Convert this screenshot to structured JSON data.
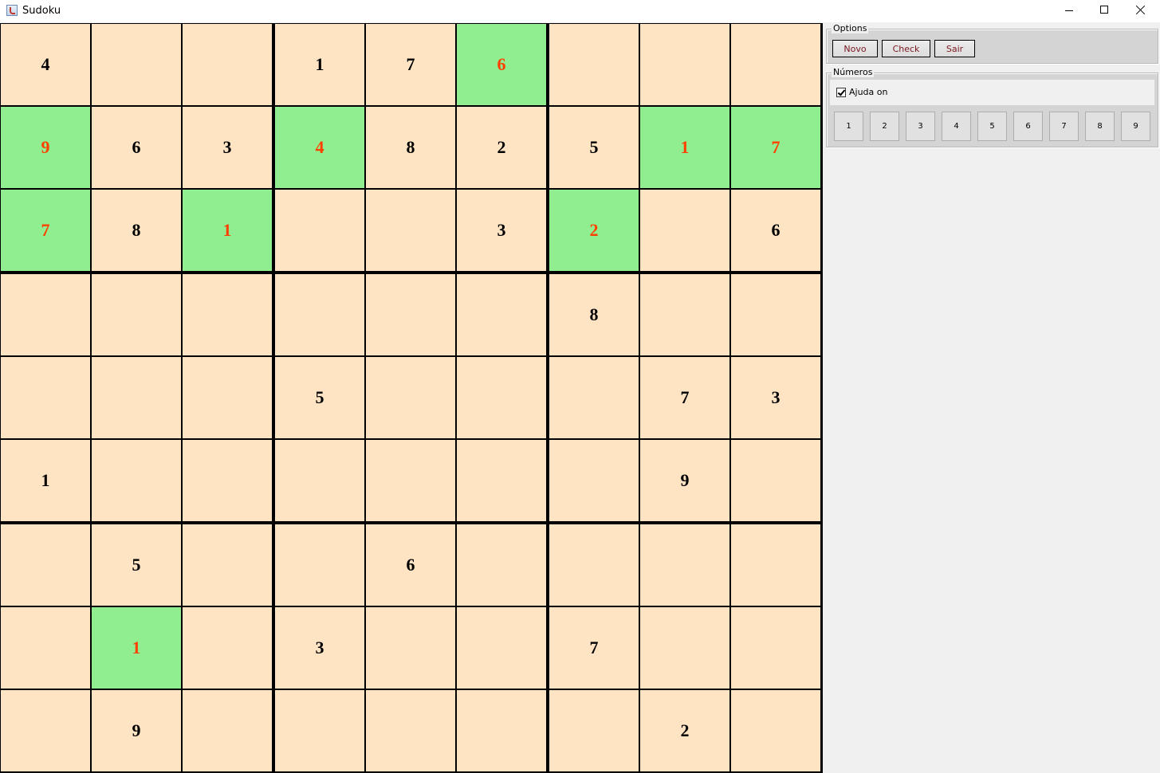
{
  "window": {
    "title": "Sudoku"
  },
  "board": {
    "rows": [
      [
        "4",
        "",
        "",
        "1",
        "7",
        "6",
        "",
        "",
        ""
      ],
      [
        "9",
        "6",
        "3",
        "4",
        "8",
        "2",
        "5",
        "1",
        "7"
      ],
      [
        "7",
        "8",
        "1",
        "",
        "",
        "3",
        "2",
        "",
        "6"
      ],
      [
        "",
        "",
        "",
        "",
        "",
        "",
        "8",
        "",
        ""
      ],
      [
        "",
        "",
        "",
        "5",
        "",
        "",
        "",
        "7",
        "3"
      ],
      [
        "1",
        "",
        "",
        "",
        "",
        "",
        "",
        "9",
        ""
      ],
      [
        "",
        "5",
        "",
        "",
        "6",
        "",
        "",
        "",
        ""
      ],
      [
        "",
        "1",
        "",
        "3",
        "",
        "",
        "7",
        "",
        ""
      ],
      [
        "",
        "9",
        "",
        "",
        "",
        "",
        "",
        "2",
        ""
      ]
    ],
    "highlighted": [
      [
        0,
        5
      ],
      [
        1,
        0
      ],
      [
        1,
        3
      ],
      [
        1,
        7
      ],
      [
        1,
        8
      ],
      [
        2,
        0
      ],
      [
        2,
        2
      ],
      [
        2,
        6
      ],
      [
        7,
        1
      ]
    ],
    "colors": {
      "cell_bg": "#ffe4c4",
      "highlight_bg": "#90ee90",
      "highlight_text": "#ff4000",
      "digit_text": "#000000"
    }
  },
  "options": {
    "legend": "Options",
    "buttons": [
      {
        "id": "novo",
        "label": "Novo"
      },
      {
        "id": "check",
        "label": "Check"
      },
      {
        "id": "sair",
        "label": "Sair"
      }
    ]
  },
  "numeros": {
    "legend": "Números",
    "help_label": "Ajuda on",
    "help_checked": true,
    "buttons": [
      "1",
      "2",
      "3",
      "4",
      "5",
      "6",
      "7",
      "8",
      "9"
    ]
  }
}
